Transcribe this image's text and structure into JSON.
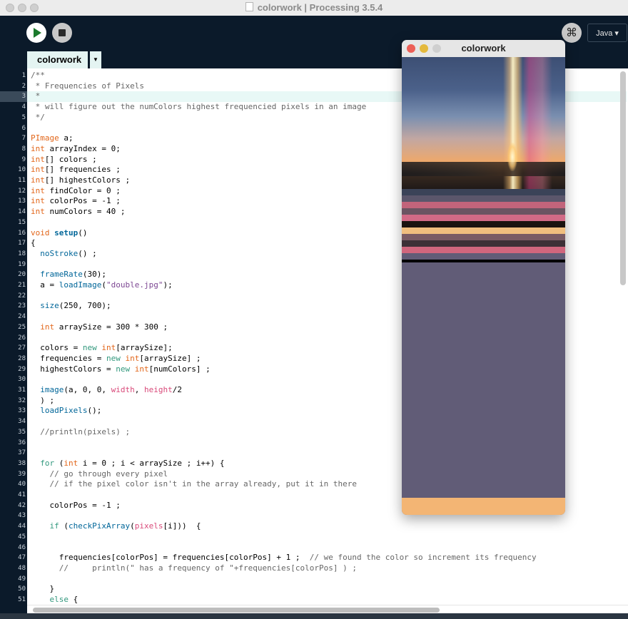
{
  "window": {
    "title": "colorwork | Processing 3.5.4"
  },
  "toolbar": {
    "run_icon": "play-icon",
    "stop_icon": "stop-icon",
    "debugger_icon": "butterfly-icon",
    "mode_label": "Java ▾"
  },
  "tabs": [
    {
      "label": "colorwork",
      "menu": "▼"
    }
  ],
  "editor": {
    "current_line": 3,
    "lines": [
      "/**",
      " * Frequencies of Pixels",
      " *",
      " * will figure out the numColors highest frequencied pixels in an image",
      " */",
      "",
      "PImage a;",
      "int arrayIndex = 0;",
      "int[] colors ;",
      "int[] frequencies ;",
      "int[] highestColors ;",
      "int findColor = 0 ;",
      "int colorPos = -1 ;",
      "int numColors = 40 ;",
      "",
      "void setup()",
      "{",
      "  noStroke() ;",
      "",
      "  frameRate(30);",
      "  a = loadImage(\"double.jpg\");",
      "",
      "  size(250, 700);",
      "",
      "  int arraySize = 300 * 300 ;",
      "",
      "  colors = new int[arraySize];",
      "  frequencies = new int[arraySize] ;",
      "  highestColors = new int[numColors] ;",
      "",
      "  image(a, 0, 0, width, height/2",
      "  ) ;",
      "  loadPixels();",
      "",
      "  //println(pixels) ;",
      "",
      "",
      "  for (int i = 0 ; i < arraySize ; i++) {",
      "    // go through every pixel",
      "    // if the pixel color isn't in the array already, put it in there",
      "",
      "    colorPos = -1 ;",
      "",
      "    if (checkPixArray(pixels[i]))  {",
      "",
      "",
      "      frequencies[colorPos] = frequencies[colorPos] + 1 ;  // we found the color so increment its frequency",
      "      //     println(\" has a frequency of \"+frequencies[colorPos] ) ;",
      "",
      "    }",
      "    else {"
    ]
  },
  "colors": {
    "comment": "#666666",
    "keyword": "#33997e",
    "type": "#e2661a",
    "function": "#006699",
    "string": "#7d4793",
    "accent": "#0b1a2a"
  },
  "sketch": {
    "title": "colorwork",
    "stripes": [
      "#3b4358",
      "#5b566b",
      "#c2647b",
      "#6b5462",
      "#d26a86",
      "#1a1310",
      "#f0be7e",
      "#7a5b64",
      "#3d3036",
      "#d0667d",
      "#615c77",
      "#000000"
    ],
    "fill": "#615c77",
    "bottom": "#f3b574"
  }
}
